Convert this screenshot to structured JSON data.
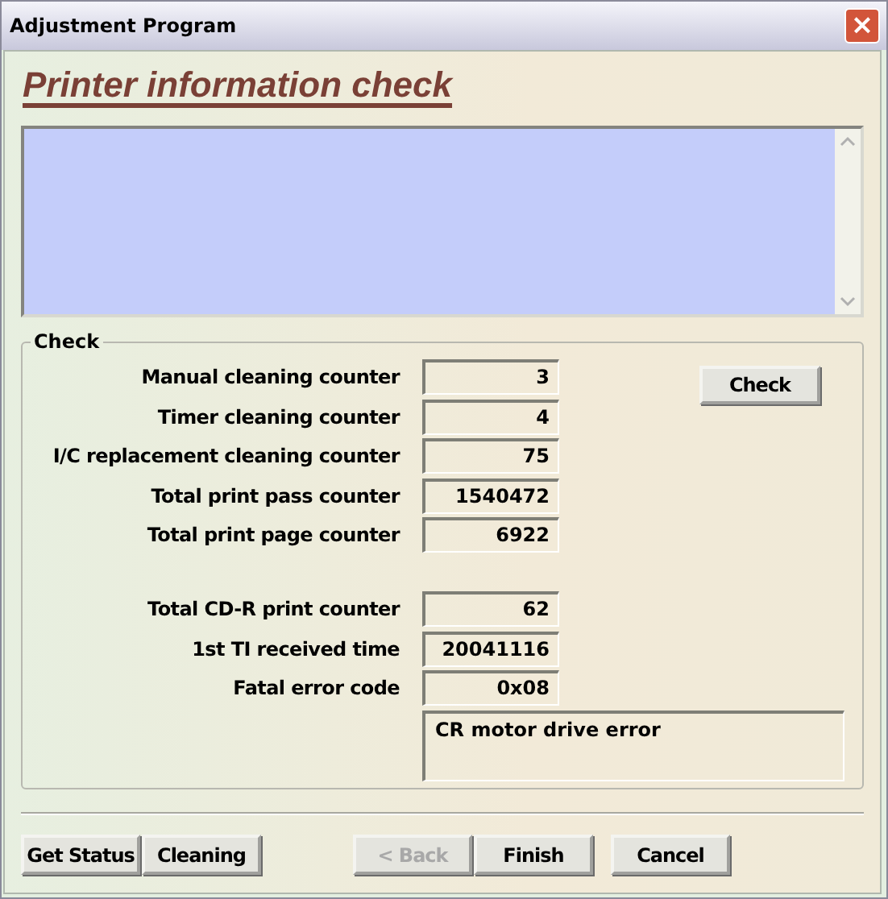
{
  "window": {
    "title": "Adjustment Program",
    "close": "×"
  },
  "heading": "Printer information check",
  "check": {
    "legend": "Check",
    "button": "Check",
    "rows": [
      {
        "label": "Manual cleaning counter",
        "value": "3"
      },
      {
        "label": "Timer cleaning counter",
        "value": "4"
      },
      {
        "label": "I/C replacement cleaning counter",
        "value": "75"
      },
      {
        "label": "Total print pass counter",
        "value": "1540472"
      },
      {
        "label": "Total print page counter",
        "value": "6922"
      }
    ],
    "more_rows": [
      {
        "label": "Total CD-R print counter",
        "value": "62"
      },
      {
        "label": "1st TI received time",
        "value": "20041116"
      },
      {
        "label": "Fatal error code",
        "value": "0x08"
      }
    ],
    "message": "CR motor drive error"
  },
  "left_buttons": [
    {
      "label": "Get Status",
      "disabled": false
    },
    {
      "label": "Cleaning",
      "disabled": false
    }
  ],
  "nav_buttons": [
    {
      "label": "< Back",
      "disabled": true
    },
    {
      "label": "Finish",
      "disabled": false
    }
  ],
  "cancel_button": {
    "label": "Cancel",
    "disabled": false
  }
}
